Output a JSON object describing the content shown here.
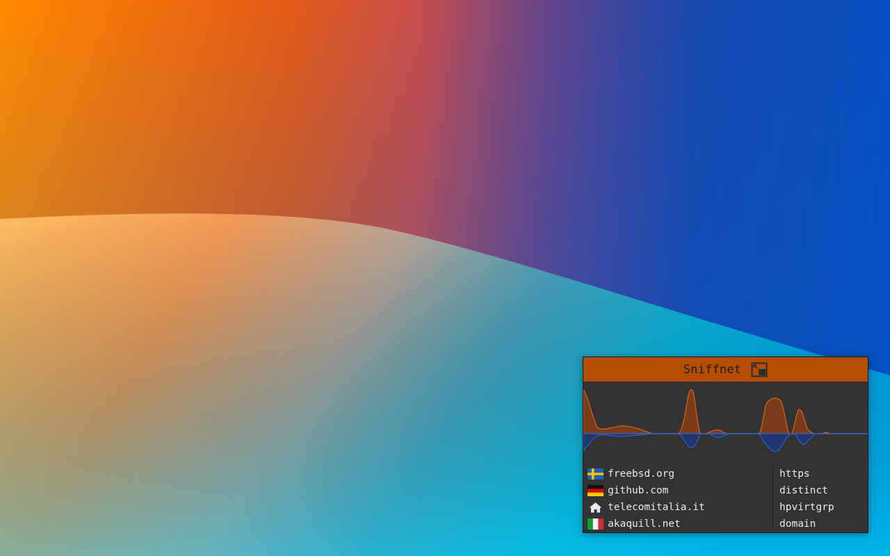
{
  "widget": {
    "title": "Sniffnet",
    "expand_icon": "expand-window-icon",
    "colors": {
      "titlebar": "#b54e00",
      "body": "#333333",
      "incoming": "#c0561b",
      "outgoing": "#1f57c4"
    },
    "hosts": [
      {
        "flag": "sweden-flag-icon",
        "name": "freebsd.org"
      },
      {
        "flag": "germany-flag-icon",
        "name": "github.com"
      },
      {
        "flag": "home-icon",
        "name": "telecomitalia.it"
      },
      {
        "flag": "italy-flag-icon",
        "name": "akaquill.net"
      }
    ],
    "services": [
      "https",
      "distinct",
      "hpvirtgrp",
      "domain"
    ]
  }
}
